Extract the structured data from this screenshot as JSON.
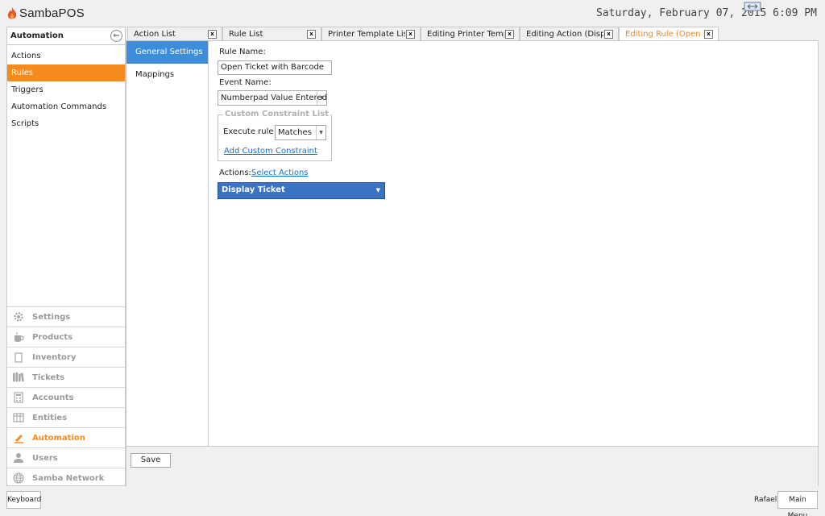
{
  "header": {
    "logo_text": "SambaPOS",
    "datetime": "Saturday, February 07, 2015 6:09 PM"
  },
  "sidebar": {
    "title": "Automation",
    "items": [
      {
        "label": "Actions",
        "active": false
      },
      {
        "label": "Rules",
        "active": true
      },
      {
        "label": "Triggers",
        "active": false
      },
      {
        "label": "Automation Commands",
        "active": false
      },
      {
        "label": "Scripts",
        "active": false
      }
    ],
    "nav": [
      {
        "label": "Settings",
        "icon": "gear-icon"
      },
      {
        "label": "Products",
        "icon": "cup-icon"
      },
      {
        "label": "Inventory",
        "icon": "box-icon"
      },
      {
        "label": "Tickets",
        "icon": "books-icon"
      },
      {
        "label": "Accounts",
        "icon": "calculator-icon"
      },
      {
        "label": "Entities",
        "icon": "table-icon"
      },
      {
        "label": "Automation",
        "icon": "pencil-icon"
      },
      {
        "label": "Users",
        "icon": "user-icon"
      },
      {
        "label": "Samba Network",
        "icon": "globe-icon"
      }
    ]
  },
  "tabs": [
    {
      "label": "Action List",
      "close": "x"
    },
    {
      "label": "Rule List",
      "close": "x"
    },
    {
      "label": "Printer Template List",
      "close": "x"
    },
    {
      "label": "Editing Printer Template",
      "close": "x"
    },
    {
      "label": "Editing Action (Display Ticket)",
      "close": "x"
    },
    {
      "label": "Editing Rule (Open Ticket with Barcode)",
      "close": "x",
      "active": true
    }
  ],
  "subnav": [
    {
      "label": "General Settings",
      "active": true
    },
    {
      "label": "Mappings",
      "active": false
    }
  ],
  "form": {
    "rule_name_label": "Rule Name:",
    "rule_name_value": "Open Ticket with Barcode",
    "event_name_label": "Event Name:",
    "event_name_value": "Numberpad Value Entered",
    "constraint_group_title": "Custom Constraint List",
    "execute_rule_label": "Execute rule if",
    "execute_rule_value": "Matches",
    "add_constraint_link": "Add Custom Constraint",
    "actions_label": "Actions:",
    "select_actions_link": "Select Actions",
    "action_item": "Display Ticket"
  },
  "footer": {
    "save_label": "Save"
  },
  "bottom_bar": {
    "keyboard_label": "Keyboard",
    "user_name": "Rafael",
    "main_menu_label": "Main Menu"
  },
  "colors": {
    "accent_orange": "#f58b1f",
    "selection_blue": "#3c8ddc",
    "action_bar_blue": "#3c72c4",
    "link_blue": "#1a6fc7"
  }
}
